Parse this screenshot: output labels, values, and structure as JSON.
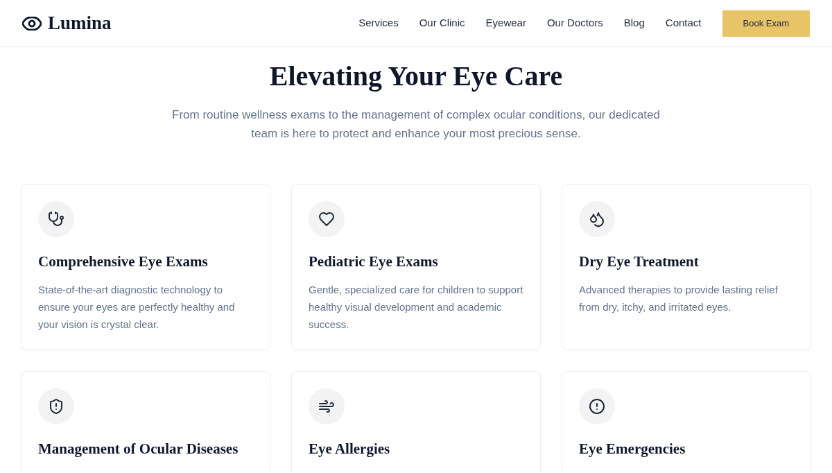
{
  "header": {
    "logo": "Lumina",
    "nav": [
      "Services",
      "Our Clinic",
      "Eyewear",
      "Our Doctors",
      "Blog",
      "Contact"
    ],
    "cta": "Book Exam"
  },
  "hero": {
    "title": "Elevating Your Eye Care",
    "subtitle": "From routine wellness exams to the management of complex ocular conditions, our dedicated team is here to protect and enhance your most precious sense."
  },
  "services": [
    {
      "title": "Comprehensive Eye Exams",
      "description": "State-of-the-art diagnostic technology to ensure your eyes are perfectly healthy and your vision is crystal clear."
    },
    {
      "title": "Pediatric Eye Exams",
      "description": "Gentle, specialized care for children to support healthy visual development and academic success."
    },
    {
      "title": "Dry Eye Treatment",
      "description": "Advanced therapies to provide lasting relief from dry, itchy, and irritated eyes."
    },
    {
      "title": "Management of Ocular Diseases"
    },
    {
      "title": "Eye Allergies"
    },
    {
      "title": "Eye Emergencies"
    }
  ]
}
